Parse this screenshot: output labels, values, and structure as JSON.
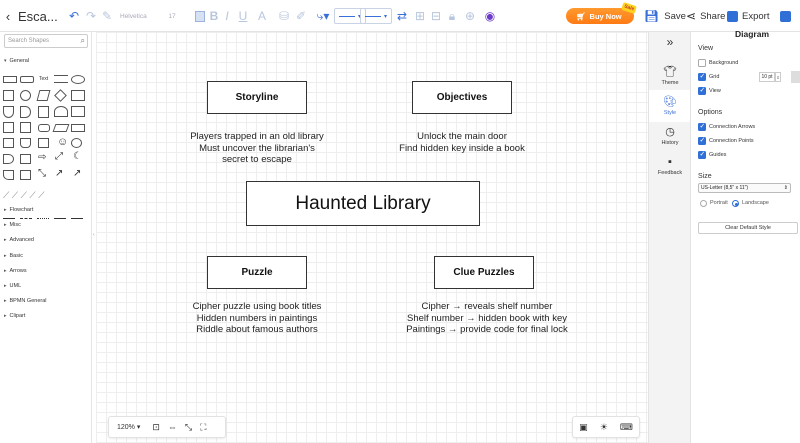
{
  "app": {
    "title": "Esca...",
    "font": "Helvetica",
    "font_size": "17",
    "buy_now": "Buy Now",
    "buy_badge": "Sale",
    "save": "Save",
    "share": "Share",
    "export": "Export"
  },
  "left": {
    "search_placeholder": "Search Shapes",
    "general": "General",
    "categories": [
      "Flowchart",
      "Misc",
      "Advanced",
      "Basic",
      "Arrows",
      "UML",
      "BPMN General",
      "Clipart"
    ]
  },
  "canvas": {
    "center": "Haunted Library",
    "nodes": [
      {
        "label": "Storyline",
        "lines": [
          "Players trapped in an old library",
          "Must uncover the librarian's",
          "secret to escape"
        ]
      },
      {
        "label": "Objectives",
        "lines": [
          "Unlock the main door",
          "Find hidden key inside a book"
        ]
      },
      {
        "label": "Puzzle",
        "lines": [
          "Cipher puzzle using book titles",
          "Hidden numbers in paintings",
          "Riddle about famous authors"
        ]
      },
      {
        "label": "Clue Puzzles",
        "lines": [
          "Cipher → reveals shelf number",
          "Shelf number → hidden book with key",
          "Paintings → provide code for final lock"
        ]
      }
    ],
    "zoom": "120%"
  },
  "tabs": {
    "theme": "Theme",
    "style": "Style",
    "history": "History",
    "feedback": "Feedback"
  },
  "panel": {
    "title": "Diagram",
    "view": "View",
    "background": "Background",
    "grid": "Grid",
    "grid_pt": "10 pt",
    "view_chk": "View",
    "options": "Options",
    "connection_arrows": "Connection Arrows",
    "connection_points": "Connection Points",
    "guides": "Guides",
    "size": "Size",
    "paper": "US-Letter (8,5\" x 11\")",
    "portrait": "Portrait",
    "landscape": "Landscape",
    "clear": "Clear Default Style"
  },
  "colors": {
    "accent": "#3a6fd8",
    "buy": "#ff8a1f"
  }
}
